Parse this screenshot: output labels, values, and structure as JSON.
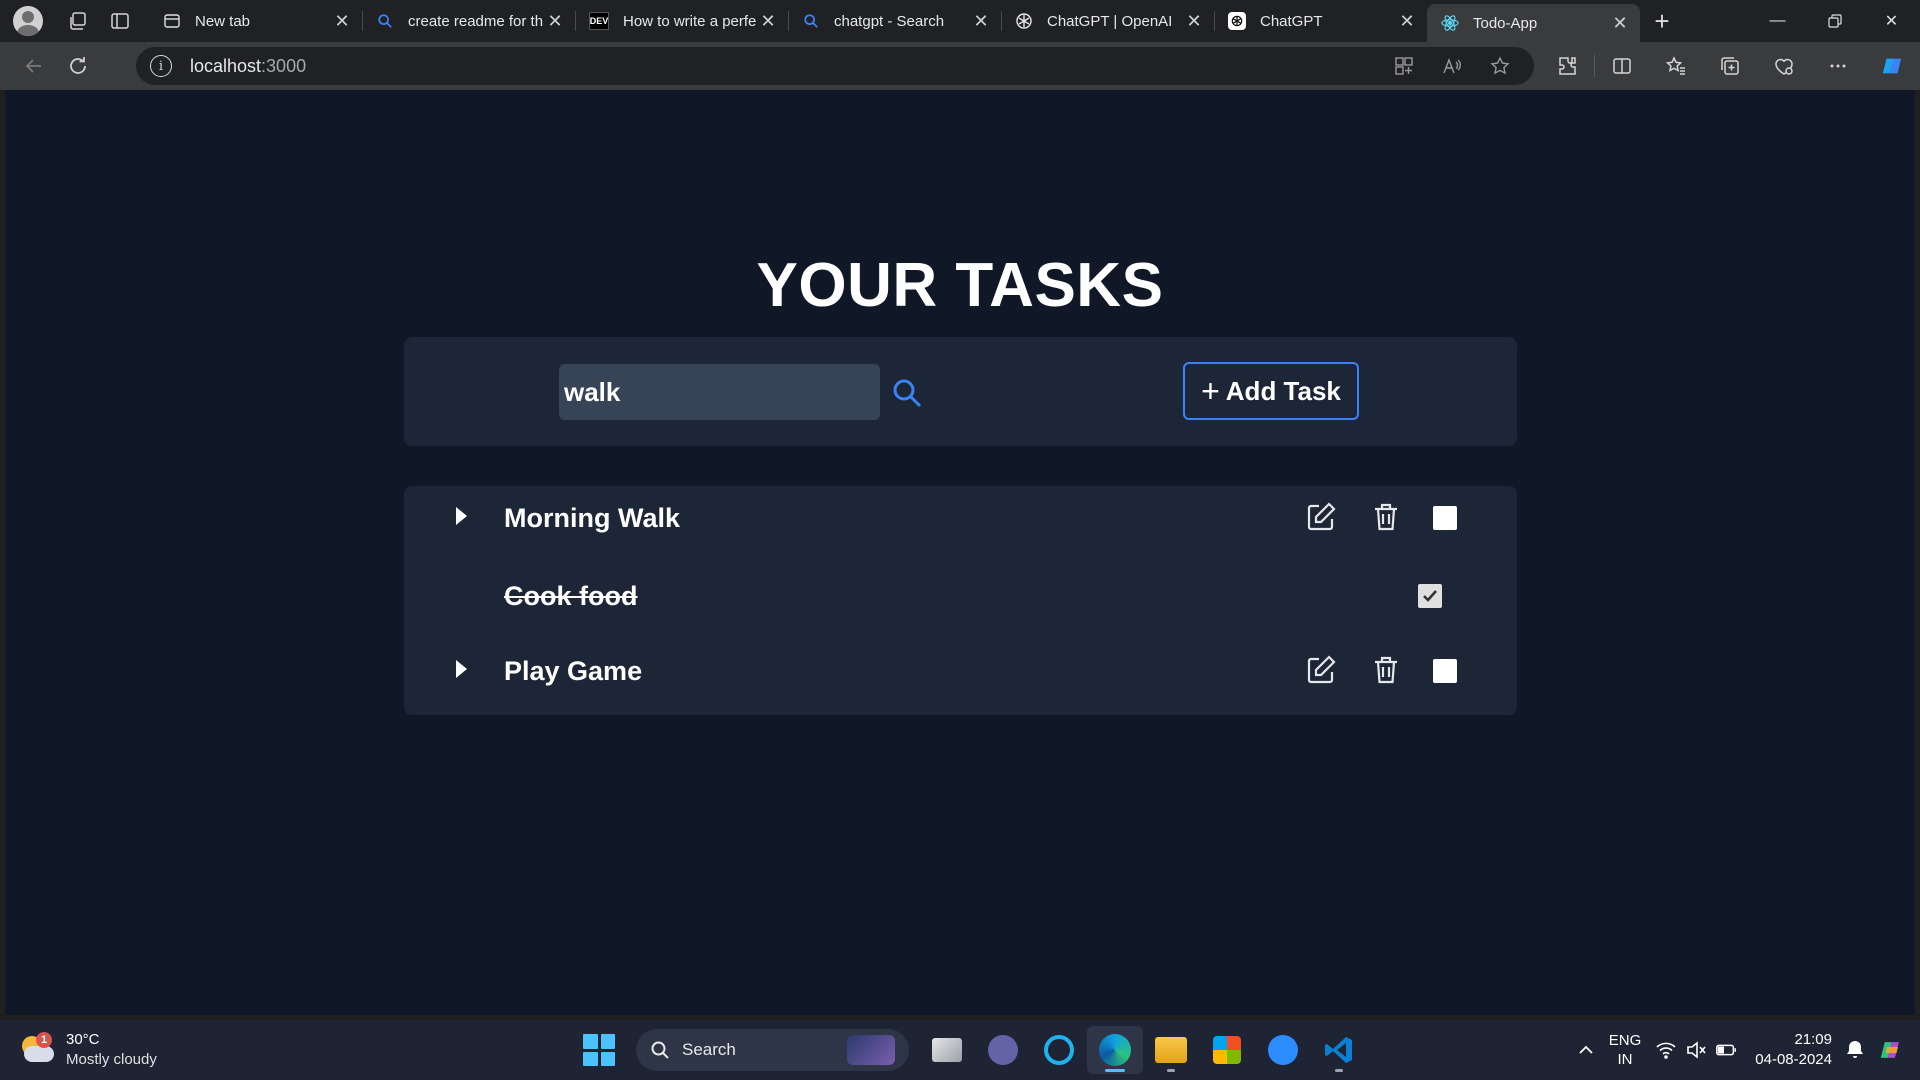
{
  "browser": {
    "tabs": [
      {
        "title": "New tab",
        "icon": "newtab-icon",
        "active": false
      },
      {
        "title": "create readme for th",
        "icon": "search-icon",
        "active": false
      },
      {
        "title": "How to write a perfe",
        "icon": "dev-icon",
        "active": false
      },
      {
        "title": "chatgpt - Search",
        "icon": "search-icon",
        "active": false
      },
      {
        "title": "ChatGPT | OpenAI",
        "icon": "openai-icon",
        "active": false
      },
      {
        "title": "ChatGPT",
        "icon": "openai-icon",
        "active": false
      },
      {
        "title": "Todo-App",
        "icon": "react-icon",
        "active": true
      }
    ],
    "dev_label": "DEV",
    "url_host": "localhost",
    "url_port": ":3000"
  },
  "app": {
    "title": "YOUR TASKS",
    "search_value": "walk",
    "add_button_label": "Add Task",
    "accent_color": "#3b82f6",
    "background_color": "#101828",
    "panel_color": "#1d2636",
    "tasks": [
      {
        "title": "Morning Walk",
        "completed": false,
        "expandable": true
      },
      {
        "title": "Cook food",
        "completed": true,
        "expandable": false
      },
      {
        "title": "Play Game",
        "completed": false,
        "expandable": true
      }
    ]
  },
  "taskbar": {
    "weather_temp": "30°C",
    "weather_condition": "Mostly cloudy",
    "weather_badge": "1",
    "search_label": "Search",
    "lang_line1": "ENG",
    "lang_line2": "IN",
    "time": "21:09",
    "date": "04-08-2024"
  }
}
